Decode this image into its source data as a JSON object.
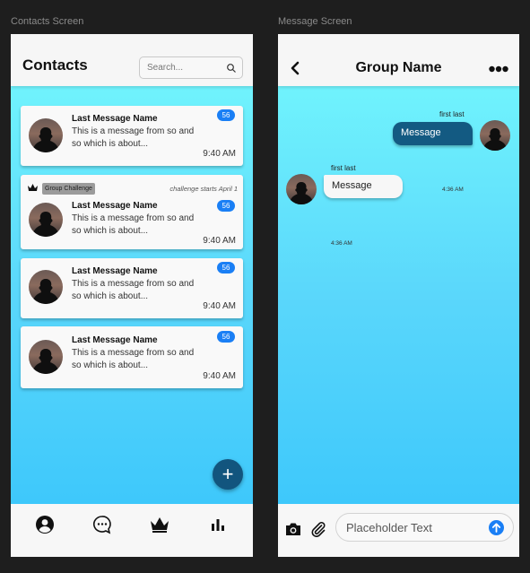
{
  "labels": {
    "contacts_screen": "Contacts Screen",
    "message_screen": "Message Screen"
  },
  "contacts": {
    "title": "Contacts",
    "search_placeholder": "Search...",
    "cards": [
      {
        "name": "Last Message Name",
        "message": "This is a message from so and so which is about...",
        "time": "9:40 AM",
        "badge": "56"
      },
      {
        "tag": "Group Challenge",
        "challenge_note": "challenge starts April 1",
        "name": "Last Message Name",
        "message": "This is a message from so and so which is about...",
        "time": "9:40 AM",
        "badge": "56"
      },
      {
        "name": "Last Message Name",
        "message": "This is a message from so and so which is about...",
        "time": "9:40 AM",
        "badge": "56"
      },
      {
        "name": "Last Message Name",
        "message": "This is a message from so and so which is about...",
        "time": "9:40 AM",
        "badge": "56"
      }
    ],
    "fab_label": "+",
    "nav_icons": [
      "profile-icon",
      "chat-icon",
      "crown-icon",
      "stats-icon"
    ]
  },
  "chat": {
    "title": "Group Name",
    "messages": [
      {
        "sender": "first last",
        "text": "Message",
        "time": "4:36 AM",
        "direction": "outgoing"
      },
      {
        "sender": "first last",
        "text": "Message",
        "time": "4:36 AM",
        "direction": "incoming"
      }
    ],
    "input_placeholder": "Placeholder Text"
  },
  "colors": {
    "accent": "#1a7ff5",
    "fab": "#12557e",
    "gradient_top": "#70f3fd",
    "gradient_bottom": "#3ec8fb"
  }
}
